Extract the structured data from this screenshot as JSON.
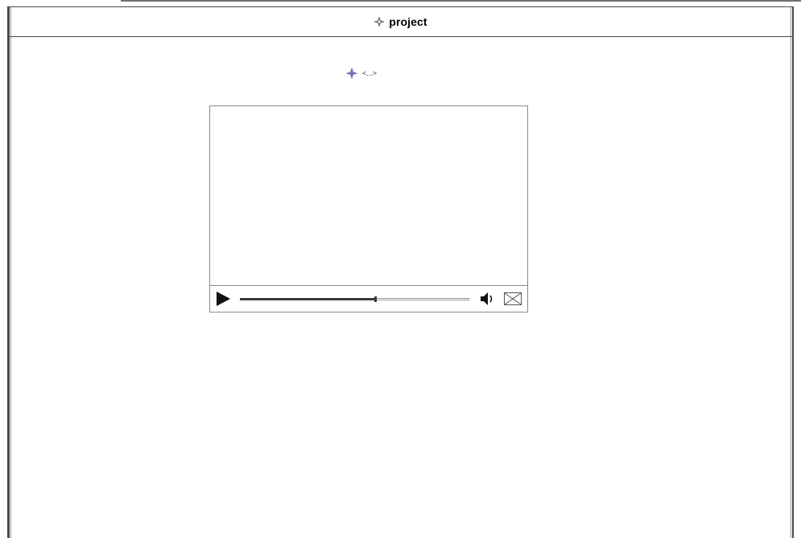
{
  "window": {
    "title": "project",
    "title_icon": "diamond-star-icon"
  },
  "child_element": {
    "label": "<...>",
    "icon": "sparkle-star-icon",
    "icon_color": "#7a5fb0"
  },
  "video_player": {
    "playback_progress": 0.59,
    "controls": {
      "play_icon": "play-icon",
      "volume_icon": "volume-icon",
      "fullscreen_icon": "fullscreen-icon"
    }
  }
}
